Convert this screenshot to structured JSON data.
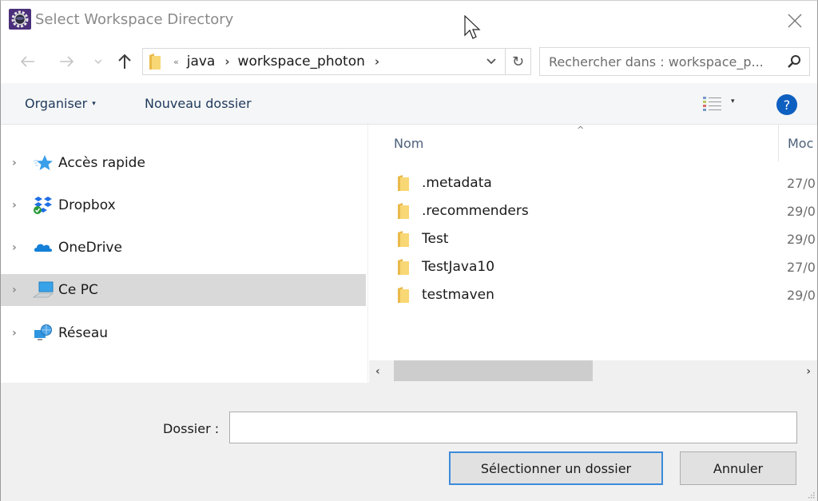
{
  "window": {
    "title": "Select Workspace Directory",
    "app_icon": "eclipse-gear-icon",
    "close_icon": "close-icon"
  },
  "navbar": {
    "back_icon": "arrow-left-icon",
    "forward_icon": "arrow-right-icon",
    "recent_icon": "chevron-down-icon",
    "up_icon": "arrow-up-icon",
    "overflow_glyph": "«",
    "breadcrumb": [
      {
        "label": "java"
      },
      {
        "label": "workspace_photon"
      }
    ],
    "separator_glyph": "›",
    "dropdown_glyph": "⌄",
    "refresh_glyph": "↻",
    "search_placeholder": "Rechercher dans : workspace_p..."
  },
  "commandbar": {
    "organise_label": "Organiser",
    "organise_caret": "▾",
    "new_folder_label": "Nouveau dossier",
    "view_caret": "▾",
    "help_label": "?"
  },
  "navpane": {
    "expand_glyph": "›",
    "items": [
      {
        "label": "Accès rapide",
        "icon": "quick-access-star-icon",
        "selected": false
      },
      {
        "label": "Dropbox",
        "icon": "dropbox-icon",
        "selected": false
      },
      {
        "label": "OneDrive",
        "icon": "onedrive-cloud-icon",
        "selected": false
      },
      {
        "label": "Ce PC",
        "icon": "computer-icon",
        "selected": true
      },
      {
        "label": "Réseau",
        "icon": "network-icon",
        "selected": false
      }
    ]
  },
  "filelist": {
    "sort_glyph": "^",
    "columns": [
      {
        "label": "Nom"
      },
      {
        "label": "Moc"
      }
    ],
    "rows": [
      {
        "name": ".metadata",
        "date": "27/0"
      },
      {
        "name": ".recommenders",
        "date": "29/0"
      },
      {
        "name": "Test",
        "date": "29/0"
      },
      {
        "name": "TestJava10",
        "date": "27/0"
      },
      {
        "name": "testmaven",
        "date": "29/0"
      }
    ]
  },
  "hscroll": {
    "left_glyph": "‹",
    "right_glyph": "›"
  },
  "footer": {
    "folder_label": "Dossier :",
    "folder_value": "",
    "select_button": "Sélectionner un dossier",
    "cancel_button": "Annuler"
  },
  "colors": {
    "accent": "#3c8bdb",
    "help": "#0d5fc0",
    "selected_bg": "#d9d9d9",
    "folder": "#f2c94c"
  }
}
